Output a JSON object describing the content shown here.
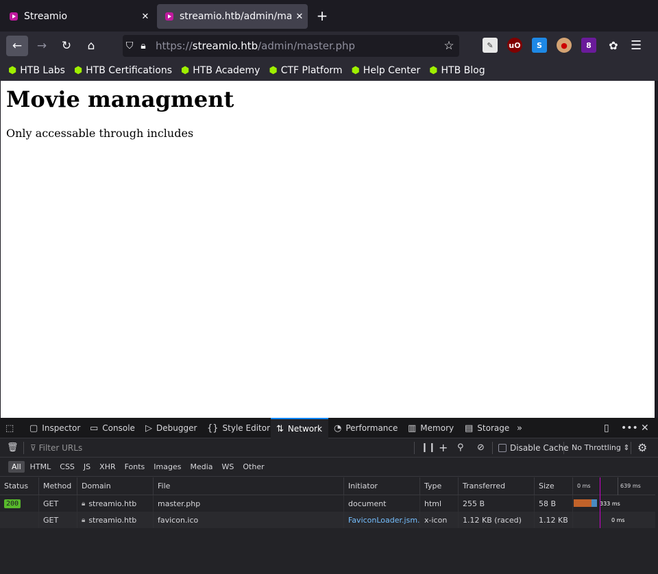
{
  "browser": {
    "tabs": [
      {
        "title": "Streamio",
        "active": false
      },
      {
        "title": "streamio.htb/admin/mast",
        "active": true
      }
    ],
    "url": {
      "host": "streamio.htb",
      "scheme": "https://",
      "path": "/admin/master.php"
    },
    "bookmarks": [
      "HTB Labs",
      "HTB Certifications",
      "HTB Academy",
      "CTF Platform",
      "Help Center",
      "HTB Blog"
    ],
    "extension_badge": "8"
  },
  "page": {
    "heading": "Movie managment",
    "text": "Only accessable through includes"
  },
  "devtools": {
    "tabs": [
      "Inspector",
      "Console",
      "Debugger",
      "Style Editor",
      "Network",
      "Performance",
      "Memory",
      "Storage"
    ],
    "active_tab": "Network",
    "filter_placeholder": "Filter URLs",
    "disable_cache_label": "Disable Cache",
    "throttling": "No Throttling",
    "type_filters": [
      "All",
      "HTML",
      "CSS",
      "JS",
      "XHR",
      "Fonts",
      "Images",
      "Media",
      "WS",
      "Other"
    ],
    "columns": [
      "Status",
      "Method",
      "Domain",
      "File",
      "Initiator",
      "Type",
      "Transferred",
      "Size"
    ],
    "timeline_ticks": [
      "0 ms",
      "639 ms"
    ],
    "requests": [
      {
        "status": "200",
        "method": "GET",
        "domain": "streamio.htb",
        "file": "master.php",
        "initiator": "document",
        "type": "html",
        "transferred": "255 B",
        "size": "58 B",
        "timing": "333 ms"
      },
      {
        "status": "",
        "method": "GET",
        "domain": "streamio.htb",
        "file": "favicon.ico",
        "initiator": "FaviconLoader.jsm...",
        "type": "x-icon",
        "transferred": "1.12 KB (raced)",
        "size": "1.12 KB",
        "timing": "0 ms"
      }
    ]
  },
  "colors": {
    "accent": "#0a84ff",
    "htb_green": "#9fef00",
    "status_ok": "#58b92c"
  }
}
